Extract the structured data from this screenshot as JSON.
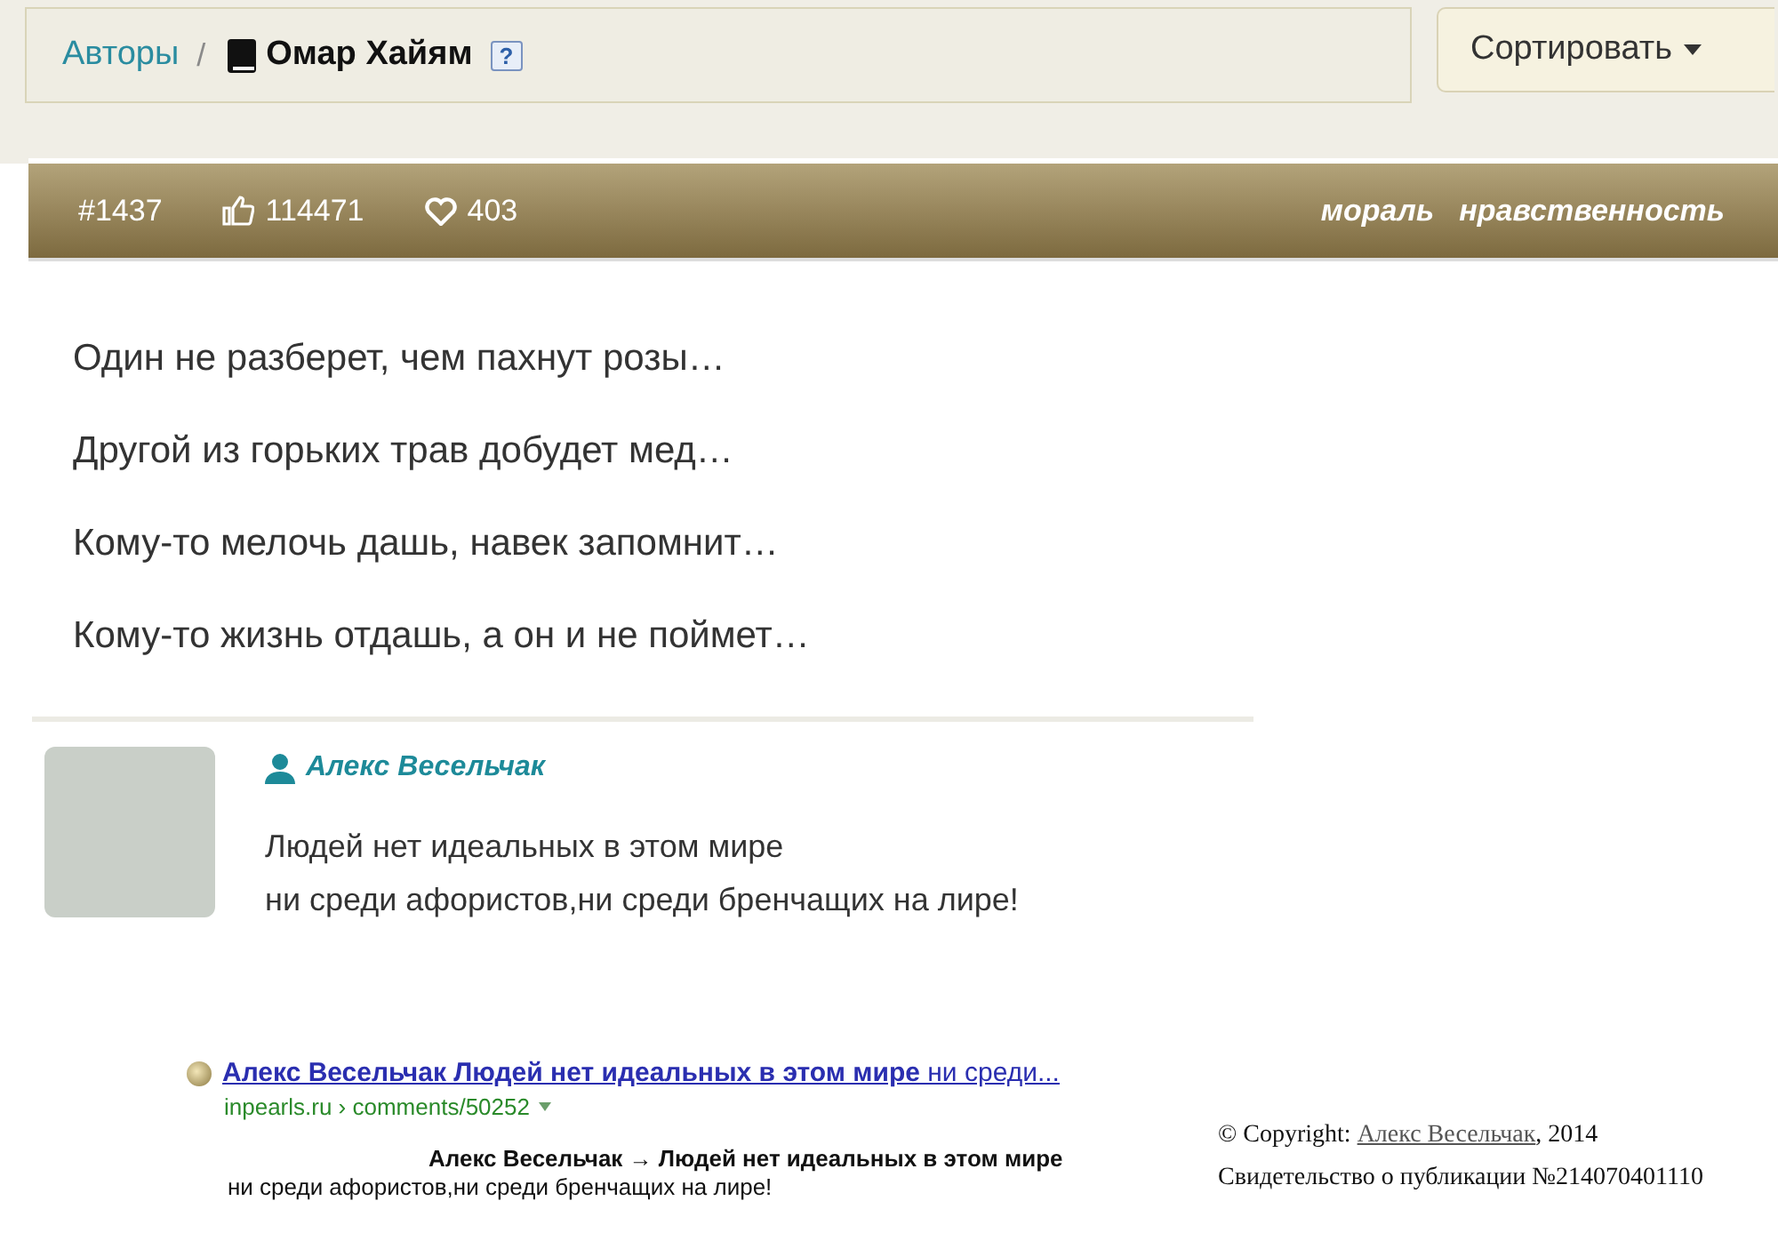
{
  "breadcrumb": {
    "parent": "Авторы",
    "separator": "/",
    "current": "Омар Хайям",
    "help": "?"
  },
  "sort_button": {
    "label": "Сортировать"
  },
  "quote_bar": {
    "number": "#1437",
    "likes": "114471",
    "favorites": "403",
    "tags": [
      "мораль",
      "нравственность"
    ]
  },
  "poem_lines": [
    "Один не разберет, чем пахнут розы…",
    "Другой из горьких трав добудет мед…",
    "Кому-то мелочь дашь, навек запомнит…",
    "Кому-то жизнь отдашь, а он и не поймет…"
  ],
  "comment": {
    "author": "Алекс Весельчак",
    "lines": [
      "Людей нет идеальных в этом мире",
      "ни среди афористов,ни среди бренчащих на лире!"
    ]
  },
  "search_result": {
    "title": "**Алекс Весельчак Людей нет идеальных в этом мире** ни среди...",
    "url": "inpearls.ru › comments/50252",
    "excerpt_heading": "Алекс Весельчак → Людей нет идеальных в этом мире",
    "excerpt": "ни среди афористов,ни среди бренчащих на лире!"
  },
  "copyright": {
    "prefix": "© Copyright: ",
    "author": "Алекс Весельчак",
    "suffix": ", 2014",
    "certificate": "Свидетельство о публикации №214070401110"
  }
}
